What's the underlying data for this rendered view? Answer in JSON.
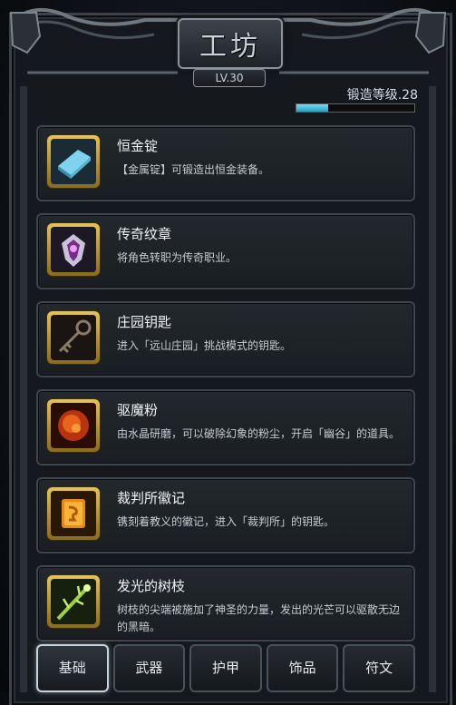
{
  "header": {
    "title": "工坊",
    "level_badge": "LV.30",
    "forge_level_label": "锻造等级.28",
    "forge_progress_fraction": 0.27
  },
  "items": [
    {
      "name": "恒金锭",
      "desc": "【金属锭】可锻造出恒金装备。",
      "icon": "metal-ingot-icon"
    },
    {
      "name": "传奇纹章",
      "desc": "将角色转职为传奇职业。",
      "icon": "legendary-crest-icon"
    },
    {
      "name": "庄园钥匙",
      "desc": "进入「远山庄园」挑战模式的钥匙。",
      "icon": "key-icon"
    },
    {
      "name": "驱魔粉",
      "desc": "由水晶研磨，可以破除幻象的粉尘，开启「幽谷」的道具。",
      "icon": "exorcism-powder-icon"
    },
    {
      "name": "裁判所徽记",
      "desc": "镌刻着教义的徽记，进入「裁判所」的钥匙。",
      "icon": "tribunal-emblem-icon"
    },
    {
      "name": "发光的树枝",
      "desc": "树枝的尖端被施加了神圣的力量，发出的光芒可以驱散无边的黑暗。",
      "icon": "glowing-branch-icon"
    }
  ],
  "tabs": [
    {
      "label": "基础",
      "active": true
    },
    {
      "label": "武器",
      "active": false
    },
    {
      "label": "护甲",
      "active": false
    },
    {
      "label": "饰品",
      "active": false
    },
    {
      "label": "符文",
      "active": false
    }
  ],
  "colors": {
    "accent_bar": "#4fc6e0",
    "icon_frame_gold": "#d7b24b",
    "panel_bg": "#1f2428"
  }
}
